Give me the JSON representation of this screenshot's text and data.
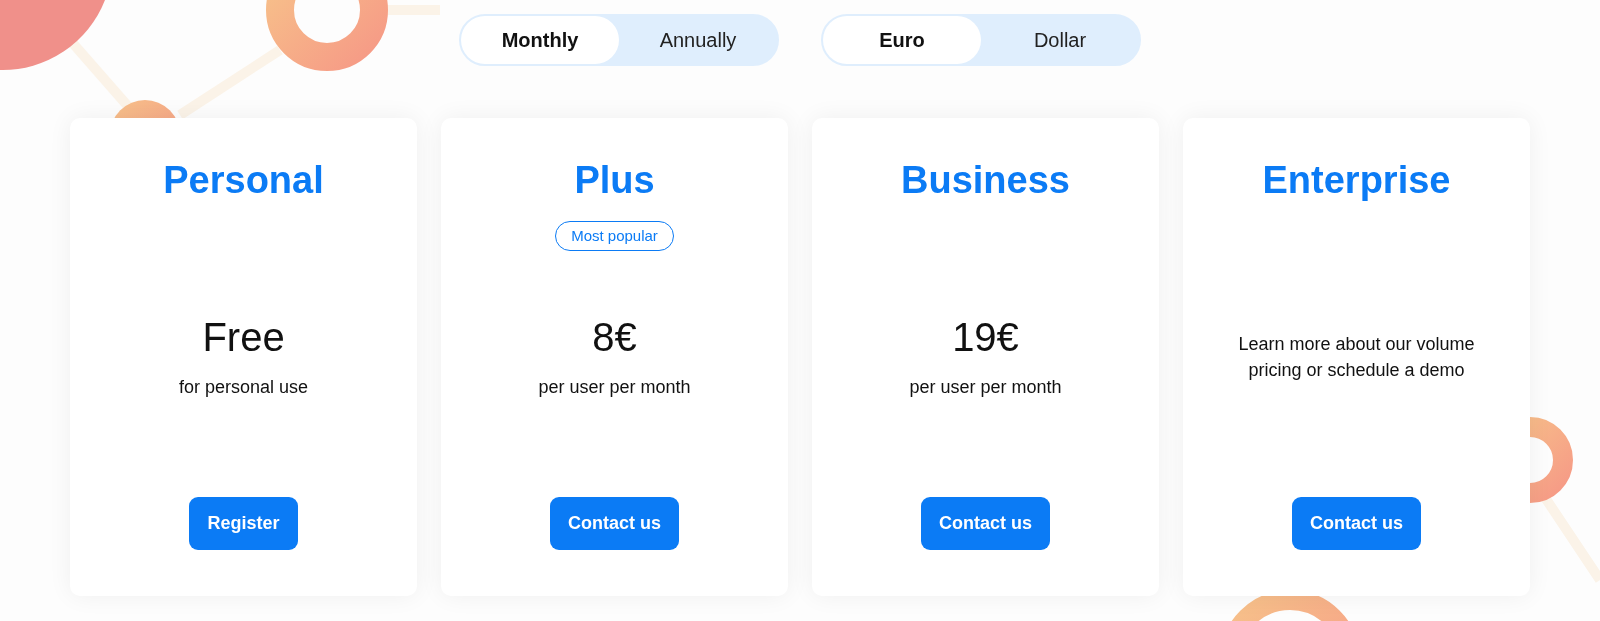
{
  "toggles": [
    {
      "options": [
        {
          "label": "Monthly",
          "selected": true
        },
        {
          "label": "Annually",
          "selected": false
        }
      ]
    },
    {
      "options": [
        {
          "label": "Euro",
          "selected": true
        },
        {
          "label": "Dollar",
          "selected": false
        }
      ]
    }
  ],
  "plans": [
    {
      "name": "Personal",
      "price": "Free",
      "description": "for personal use",
      "button": "Register"
    },
    {
      "name": "Plus",
      "badge": "Most popular",
      "price": "8€",
      "description": "per user per month",
      "button": "Contact us"
    },
    {
      "name": "Business",
      "price": "19€",
      "description": "per user per month",
      "button": "Contact us"
    },
    {
      "name": "Enterprise",
      "description": "Learn more about our volume pricing or schedule a demo",
      "button": "Contact us"
    }
  ]
}
